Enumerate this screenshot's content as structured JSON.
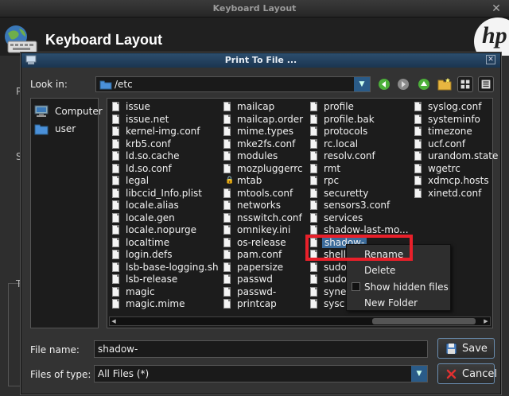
{
  "outer_window": {
    "title": "Keyboard Layout",
    "heading": "Keyboard Layout",
    "ghost_letters": {
      "p": "P",
      "s": "S",
      "t": "T"
    }
  },
  "dialog": {
    "title": "Print To File ...",
    "look_in_label": "Look in:",
    "look_in_value": "/etc",
    "sidebar": [
      {
        "label": "Computer",
        "icon": "computer-icon"
      },
      {
        "label": "user",
        "icon": "folder-icon"
      }
    ],
    "file_columns": [
      [
        "issue",
        "issue.net",
        "kernel-img.conf",
        "krb5.conf",
        "ld.so.cache",
        "ld.so.conf",
        "legal",
        "libccid_Info.plist",
        "locale.alias",
        "locale.gen",
        "locale.nopurge",
        "localtime",
        "login.defs",
        "lsb-base-logging.sh",
        "lsb-release",
        "magic",
        "magic.mime"
      ],
      [
        "mailcap",
        "mailcap.order",
        "mime.types",
        "mke2fs.conf",
        "modules",
        "mozpluggerrc",
        "mtab",
        "mtools.conf",
        "networks",
        "nsswitch.conf",
        "omnikey.ini",
        "os-release",
        "pam.conf",
        "papersize",
        "passwd",
        "passwd-",
        "printcap"
      ],
      [
        "profile",
        "profile.bak",
        "protocols",
        "rc.local",
        "resolv.conf",
        "rmt",
        "rpc",
        "securetty",
        "sensors3.conf",
        "services",
        "shadow-last-mo...",
        "shadow-",
        "shell",
        "sudo",
        "sudo",
        "syne",
        "sysc"
      ],
      [
        "syslog.conf",
        "systeminfo",
        "timezone",
        "ucf.conf",
        "urandom.state",
        "wgetrc",
        "xdmcp.hosts",
        "xinetd.conf"
      ]
    ],
    "selected_file": "shadow-",
    "context_menu": {
      "rename": "Rename",
      "delete": "Delete",
      "show_hidden": "Show hidden files",
      "new_folder": "New Folder"
    },
    "file_name_label": "File name:",
    "file_name_value": "shadow-",
    "file_type_label": "Files of type:",
    "file_type_value": "All Files (*)",
    "save_label": "Save",
    "cancel_label": "Cancel"
  },
  "colors": {
    "selection": "#3b6b9a",
    "highlight_box": "#e8202a",
    "dialog_title": "#1b3550"
  }
}
